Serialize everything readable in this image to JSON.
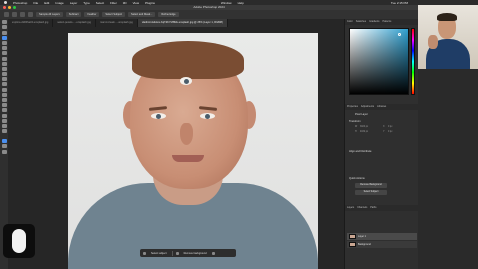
{
  "menubar": {
    "items": [
      "Photoshop",
      "File",
      "Edit",
      "Image",
      "Layer",
      "Type",
      "Select",
      "Filter",
      "3D",
      "View",
      "Plugins",
      "Window",
      "Help"
    ],
    "clock": "Tue 2:15 PM"
  },
  "window": {
    "title": "Adobe Photoshop 2024"
  },
  "options": {
    "chips": [
      "Sample All Layers",
      "Subtract",
      "Feather",
      "Select Subject",
      "Select and Mask...",
      "Refine Edge"
    ]
  },
  "tabs": [
    {
      "label": "explore-dd00ha34-unsplash.jpg",
      "active": false
    },
    {
      "label": "select-pexels-...-unsplash.jpg",
      "active": false
    },
    {
      "label": "marvin-head-...-unsplash.jpg",
      "active": false
    },
    {
      "label": "vladimir-fedotov-KqTdKYIZ8Ms-unsplash.jpg @ 25% (Layer 1, RGB/8)",
      "active": true
    }
  ],
  "taskbar": {
    "select_subject": "Select subject",
    "remove_background": "Remove background"
  },
  "panel": {
    "tabs": [
      "Color",
      "Swatches",
      "Gradients",
      "Patterns"
    ],
    "properties_tabs": [
      "Properties",
      "Adjustments",
      "Libraries"
    ],
    "pixel_layer": "Pixel Layer",
    "transform": "Transform",
    "w_label": "W",
    "w_value": "3024 px",
    "h_label": "H",
    "h_value": "4032 px",
    "x_label": "X",
    "x_value": "0 px",
    "y_label": "Y",
    "y_value": "0 px",
    "align": "Align and Distribute",
    "quick_actions": "Quick Actions",
    "remove_background": "Remove Background",
    "select_subject": "Select Subject",
    "layers_tabs": [
      "Layers",
      "Channels",
      "Paths"
    ],
    "layers": [
      {
        "name": "Layer 1",
        "selected": true
      },
      {
        "name": "Background",
        "selected": false
      }
    ]
  },
  "colors": {
    "accent": "#4a8ff0",
    "canvas_bg": "#262626"
  }
}
